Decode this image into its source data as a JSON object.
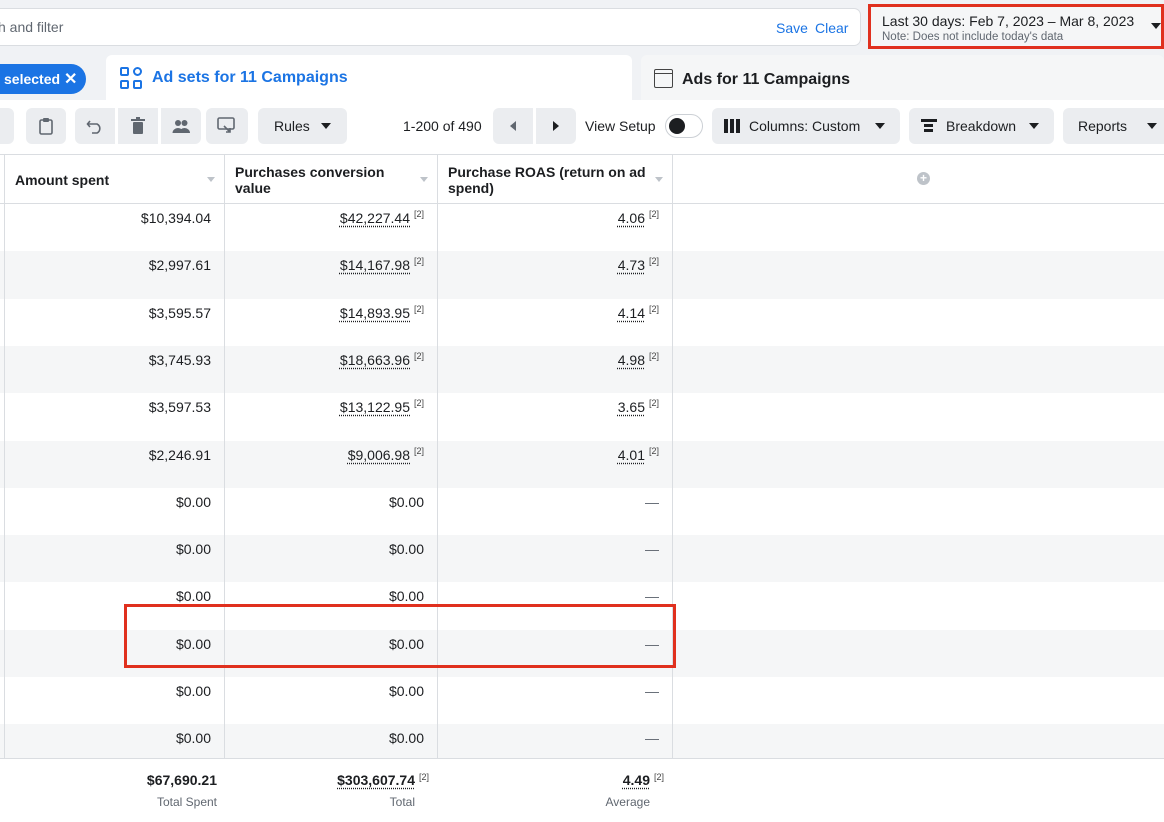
{
  "search": {
    "placeholder_text": "h and filter",
    "save": "Save",
    "clear": "Clear"
  },
  "date_range": {
    "label": "Last 30 days: Feb 7, 2023 – Mar 8, 2023",
    "note": "Note: Does not include today's data"
  },
  "selection": {
    "label": "selected",
    "close": "✕"
  },
  "tabs": [
    {
      "label": "Ad sets for 11 Campaigns",
      "active": true
    },
    {
      "label": "Ads for 11 Campaigns",
      "active": false
    }
  ],
  "toolbar": {
    "rules": "Rules",
    "pager": "1-200 of 490",
    "view_setup": "View Setup",
    "columns": "Columns: Custom",
    "breakdown": "Breakdown",
    "reports": "Reports"
  },
  "columns": [
    {
      "label": "Amount spent"
    },
    {
      "label": "Purchases conversion value"
    },
    {
      "label": "Purchase ROAS (return on ad spend)"
    }
  ],
  "footnote": "[2]",
  "rows": [
    {
      "spent": "$10,394.04",
      "value": "$42,227.44",
      "roas": "4.06"
    },
    {
      "spent": "$2,997.61",
      "value": "$14,167.98",
      "roas": "4.73"
    },
    {
      "spent": "$3,595.57",
      "value": "$14,893.95",
      "roas": "4.14"
    },
    {
      "spent": "$3,745.93",
      "value": "$18,663.96",
      "roas": "4.98"
    },
    {
      "spent": "$3,597.53",
      "value": "$13,122.95",
      "roas": "3.65"
    },
    {
      "spent": "$2,246.91",
      "value": "$9,006.98",
      "roas": "4.01"
    },
    {
      "spent": "$0.00",
      "value": "$0.00",
      "roas": "—"
    },
    {
      "spent": "$0.00",
      "value": "$0.00",
      "roas": "—"
    },
    {
      "spent": "$0.00",
      "value": "$0.00",
      "roas": "—"
    },
    {
      "spent": "$0.00",
      "value": "$0.00",
      "roas": "—"
    },
    {
      "spent": "$0.00",
      "value": "$0.00",
      "roas": "—"
    },
    {
      "spent": "$0.00",
      "value": "$0.00",
      "roas": "—"
    }
  ],
  "totals": {
    "spent": "$67,690.21",
    "spent_label": "Total Spent",
    "value": "$303,607.74",
    "value_label": "Total",
    "roas": "4.49",
    "roas_label": "Average"
  }
}
